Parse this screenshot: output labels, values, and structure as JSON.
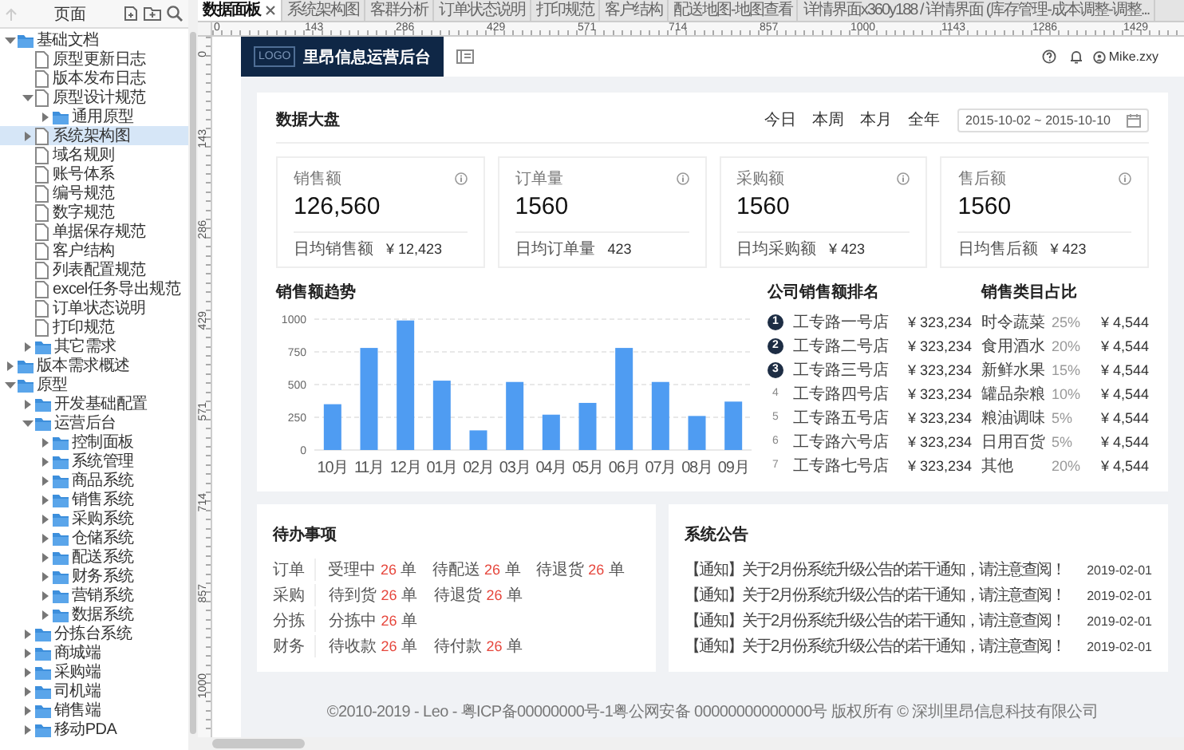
{
  "pages_panel": {
    "title": "页面",
    "tree": [
      {
        "label": "基础文档",
        "kind": "folder",
        "expanded": true,
        "selected": false,
        "children": [
          {
            "label": "原型更新日志",
            "kind": "page",
            "selected": false
          },
          {
            "label": "版本发布日志",
            "kind": "page",
            "selected": false
          },
          {
            "label": "原型设计规范",
            "kind": "page",
            "expanded": true,
            "selected": false,
            "children": [
              {
                "label": "通用原型",
                "kind": "folder",
                "expanded": false,
                "selected": false
              }
            ]
          },
          {
            "label": "系统架构图",
            "kind": "page",
            "expanded": false,
            "selected": true
          },
          {
            "label": "域名规则",
            "kind": "page",
            "selected": false
          },
          {
            "label": "账号体系",
            "kind": "page",
            "selected": false
          },
          {
            "label": "编号规范",
            "kind": "page",
            "selected": false
          },
          {
            "label": "数字规范",
            "kind": "page",
            "selected": false
          },
          {
            "label": "单据保存规范",
            "kind": "page",
            "selected": false
          },
          {
            "label": "客户结构",
            "kind": "page",
            "selected": false
          },
          {
            "label": "列表配置规范",
            "kind": "page",
            "selected": false
          },
          {
            "label": "excel任务导出规范",
            "kind": "page",
            "selected": false
          },
          {
            "label": "订单状态说明",
            "kind": "page",
            "selected": false
          },
          {
            "label": "打印规范",
            "kind": "page",
            "selected": false
          },
          {
            "label": "其它需求",
            "kind": "folder",
            "expanded": false,
            "selected": false
          }
        ]
      },
      {
        "label": "版本需求概述",
        "kind": "folder",
        "expanded": false,
        "selected": false
      },
      {
        "label": "原型",
        "kind": "folder",
        "expanded": true,
        "selected": false,
        "children": [
          {
            "label": "开发基础配置",
            "kind": "folder",
            "expanded": false,
            "selected": false
          },
          {
            "label": "运营后台",
            "kind": "folder",
            "expanded": true,
            "selected": false,
            "children": [
              {
                "label": "控制面板",
                "kind": "folder",
                "expanded": false,
                "selected": false
              },
              {
                "label": "系统管理",
                "kind": "folder",
                "expanded": false,
                "selected": false
              },
              {
                "label": "商品系统",
                "kind": "folder",
                "expanded": false,
                "selected": false
              },
              {
                "label": "销售系统",
                "kind": "folder",
                "expanded": false,
                "selected": false
              },
              {
                "label": "采购系统",
                "kind": "folder",
                "expanded": false,
                "selected": false
              },
              {
                "label": "仓储系统",
                "kind": "folder",
                "expanded": false,
                "selected": false
              },
              {
                "label": "配送系统",
                "kind": "folder",
                "expanded": false,
                "selected": false
              },
              {
                "label": "财务系统",
                "kind": "folder",
                "expanded": false,
                "selected": false
              },
              {
                "label": "营销系统",
                "kind": "folder",
                "expanded": false,
                "selected": false
              },
              {
                "label": "数据系统",
                "kind": "folder",
                "expanded": false,
                "selected": false
              }
            ]
          },
          {
            "label": "分拣台系统",
            "kind": "folder",
            "expanded": false,
            "selected": false
          },
          {
            "label": "商城端",
            "kind": "folder",
            "expanded": false,
            "selected": false
          },
          {
            "label": "采购端",
            "kind": "folder",
            "expanded": false,
            "selected": false
          },
          {
            "label": "司机端",
            "kind": "folder",
            "expanded": false,
            "selected": false
          },
          {
            "label": "销售端",
            "kind": "folder",
            "expanded": false,
            "selected": false
          },
          {
            "label": "移动PDA",
            "kind": "folder",
            "expanded": false,
            "selected": false
          }
        ]
      }
    ]
  },
  "tabs": [
    {
      "label": "数据面板",
      "selected": true,
      "closable": true
    },
    {
      "label": "系统架构图",
      "selected": false,
      "closable": false
    },
    {
      "label": "客群分析",
      "selected": false,
      "closable": false
    },
    {
      "label": "订单状态说明",
      "selected": false,
      "closable": false
    },
    {
      "label": "打印规范",
      "selected": false,
      "closable": false
    },
    {
      "label": "客户结构",
      "selected": false,
      "closable": false
    },
    {
      "label": "配送地图-地图查看",
      "selected": false,
      "closable": false
    },
    {
      "label": "详情界面x360y188 / 详情界面 (库存管理-成本调整-调整...",
      "selected": false,
      "closable": false
    }
  ],
  "rulers": {
    "horizontal": [
      "0",
      "143",
      "286",
      "429",
      "571",
      "714",
      "857",
      "1000",
      "1143",
      "1286",
      "1429"
    ],
    "vertical": [
      "0",
      "143",
      "286",
      "429",
      "571",
      "714",
      "857",
      "1000"
    ]
  },
  "app": {
    "logo": "LOGO",
    "title": "里昂信息运营后台",
    "user": "Mike.zxy"
  },
  "overview": {
    "title": "数据大盘",
    "ranges": [
      {
        "label": "今日",
        "selected": false
      },
      {
        "label": "本周",
        "selected": false
      },
      {
        "label": "本月",
        "selected": false
      },
      {
        "label": "全年",
        "selected": false
      }
    ],
    "date_range": "2015-10-02 ~ 2015-10-10",
    "stats": [
      {
        "label": "销售额",
        "value": "126,560",
        "footer_label": "日均销售额",
        "footer_value": "¥ 12,423"
      },
      {
        "label": "订单量",
        "value": "1560",
        "footer_label": "日均订单量",
        "footer_value": "423"
      },
      {
        "label": "采购额",
        "value": "1560",
        "footer_label": "日均采购额",
        "footer_value": "¥ 423"
      },
      {
        "label": "售后额",
        "value": "1560",
        "footer_label": "日均售后额",
        "footer_value": "¥ 423"
      }
    ],
    "trend": {
      "chart_data": {
        "type": "bar",
        "title": "销售额趋势",
        "categories": [
          "10月",
          "11月",
          "12月",
          "01月",
          "02月",
          "03月",
          "04月",
          "05月",
          "06月",
          "07月",
          "08月",
          "09月"
        ],
        "values": [
          350,
          780,
          990,
          530,
          150,
          520,
          270,
          360,
          780,
          520,
          260,
          370
        ],
        "ylim": [
          0,
          1000
        ],
        "yticks": [
          0,
          250,
          500,
          750,
          1000
        ],
        "grid": true
      }
    },
    "ranking": {
      "title": "公司销售额排名",
      "rows": [
        {
          "rank": "1",
          "name": "工专路一号店",
          "amount": "¥ 323,234",
          "highlighted": true
        },
        {
          "rank": "2",
          "name": "工专路二号店",
          "amount": "¥ 323,234",
          "highlighted": true
        },
        {
          "rank": "3",
          "name": "工专路三号店",
          "amount": "¥ 323,234",
          "highlighted": true
        },
        {
          "rank": "4",
          "name": "工专路四号店",
          "amount": "¥ 323,234",
          "highlighted": false
        },
        {
          "rank": "5",
          "name": "工专路五号店",
          "amount": "¥ 323,234",
          "highlighted": false
        },
        {
          "rank": "6",
          "name": "工专路六号店",
          "amount": "¥ 323,234",
          "highlighted": false
        },
        {
          "rank": "7",
          "name": "工专路七号店",
          "amount": "¥ 323,234",
          "highlighted": false
        }
      ]
    },
    "categories": {
      "title": "销售类目占比",
      "rows": [
        {
          "name": "时令蔬菜",
          "share": "25%",
          "amount": "¥ 4,544"
        },
        {
          "name": "食用酒水",
          "share": "20%",
          "amount": "¥ 4,544"
        },
        {
          "name": "新鲜水果",
          "share": "15%",
          "amount": "¥ 4,544"
        },
        {
          "name": "罐品杂粮",
          "share": "10%",
          "amount": "¥ 4,544"
        },
        {
          "name": "粮油调味",
          "share": "5%",
          "amount": "¥ 4,544"
        },
        {
          "name": "日用百货",
          "share": "5%",
          "amount": "¥ 4,544"
        },
        {
          "name": "其他",
          "share": "20%",
          "amount": "¥ 4,544"
        }
      ]
    }
  },
  "todo": {
    "title": "待办事项",
    "groups": [
      {
        "label": "订单",
        "items": [
          {
            "label": "受理中",
            "count": "26",
            "unit": "单"
          },
          {
            "label": "待配送",
            "count": "26",
            "unit": "单"
          },
          {
            "label": "待退货",
            "count": "26",
            "unit": "单"
          }
        ]
      },
      {
        "label": "采购",
        "items": [
          {
            "label": "待到货",
            "count": "26",
            "unit": "单"
          },
          {
            "label": "待退货",
            "count": "26",
            "unit": "单"
          }
        ]
      },
      {
        "label": "分拣",
        "items": [
          {
            "label": "分拣中",
            "count": "26",
            "unit": "单"
          }
        ]
      },
      {
        "label": "财务",
        "items": [
          {
            "label": "待收款",
            "count": "26",
            "unit": "单"
          },
          {
            "label": "待付款",
            "count": "26",
            "unit": "单"
          }
        ]
      }
    ]
  },
  "notices": {
    "title": "系统公告",
    "rows": [
      {
        "text": "【通知】关于2月份系统升级公告的若干通知，请注意查阅！",
        "date": "2019-02-01"
      },
      {
        "text": "【通知】关于2月份系统升级公告的若干通知，请注意查阅！",
        "date": "2019-02-01"
      },
      {
        "text": "【通知】关于2月份系统升级公告的若干通知，请注意查阅！",
        "date": "2019-02-01"
      },
      {
        "text": "【通知】关于2月份系统升级公告的若干通知，请注意查阅！",
        "date": "2019-02-01"
      }
    ]
  },
  "footer": "©2010-2019 - Leo - 粤ICP备00000000号-1粤公网安备 00000000000000号 版权所有 © 深圳里昂信息科技有限公司"
}
